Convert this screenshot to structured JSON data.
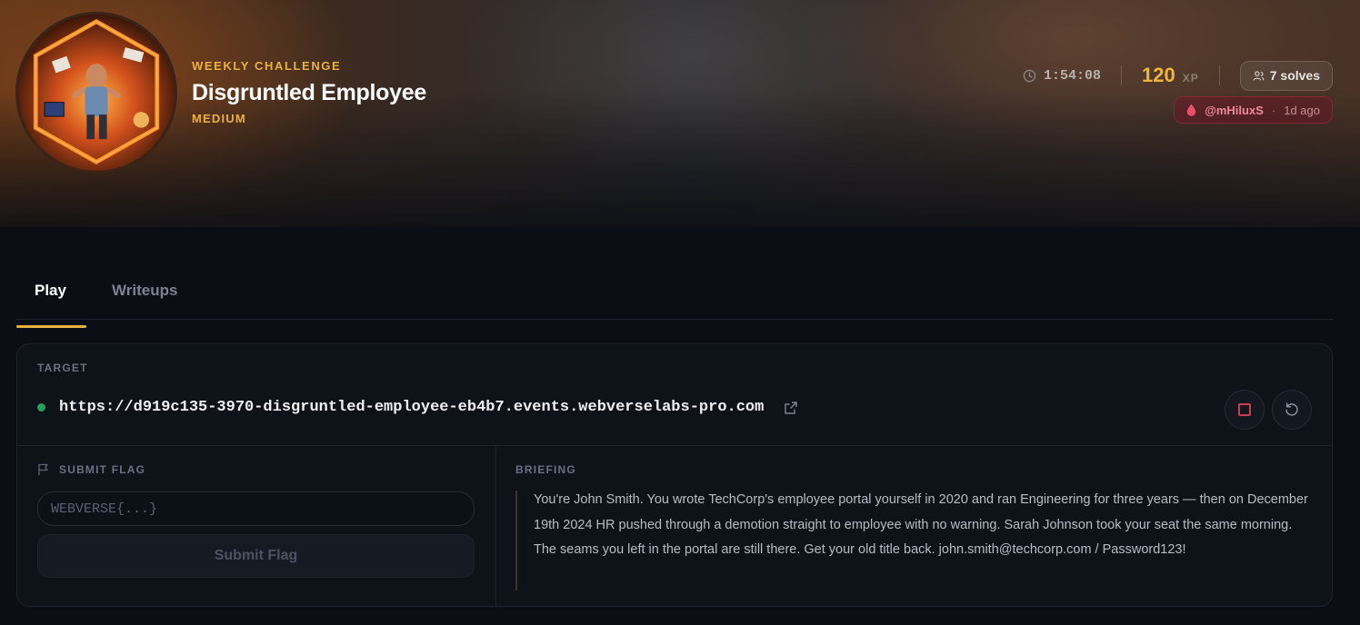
{
  "challenge": {
    "eyebrow": "WEEKLY CHALLENGE",
    "title": "Disgruntled Employee",
    "difficulty": "MEDIUM",
    "avatar_icon": "challenge-artwork-hexagon"
  },
  "stats": {
    "timer": "1:54:08",
    "xp_value": "120",
    "xp_unit": "XP",
    "solves": "7 solves",
    "first_blood_user": "@mHiluxS",
    "first_blood_sep": "·",
    "first_blood_time": "1d ago"
  },
  "tabs": [
    {
      "label": "Play",
      "active": true
    },
    {
      "label": "Writeups",
      "active": false
    }
  ],
  "target": {
    "label": "TARGET",
    "url": "https://d919c135-3970-disgruntled-employee-eb4b7.events.webverselabs-pro.com",
    "status": "online"
  },
  "flag": {
    "label": "SUBMIT FLAG",
    "placeholder": "WEBVERSE{...}",
    "button": "Submit Flag"
  },
  "briefing": {
    "label": "BRIEFING",
    "text": "You're John Smith. You wrote TechCorp's employee portal yourself in 2020 and ran Engineering for three years — then on December 19th 2024 HR pushed through a demotion straight to employee with no warning. Sarah Johnson took your seat the same morning. The seams you left in the portal are still there. Get your old title back. john.smith@techcorp.com / Password123!"
  },
  "colors": {
    "accent": "#e9b140",
    "xp": "#f2b53a",
    "status_online": "#22a35a",
    "first_blood": "#ee8a9a",
    "stop": "#c9404c",
    "background": "#0b0e14"
  }
}
